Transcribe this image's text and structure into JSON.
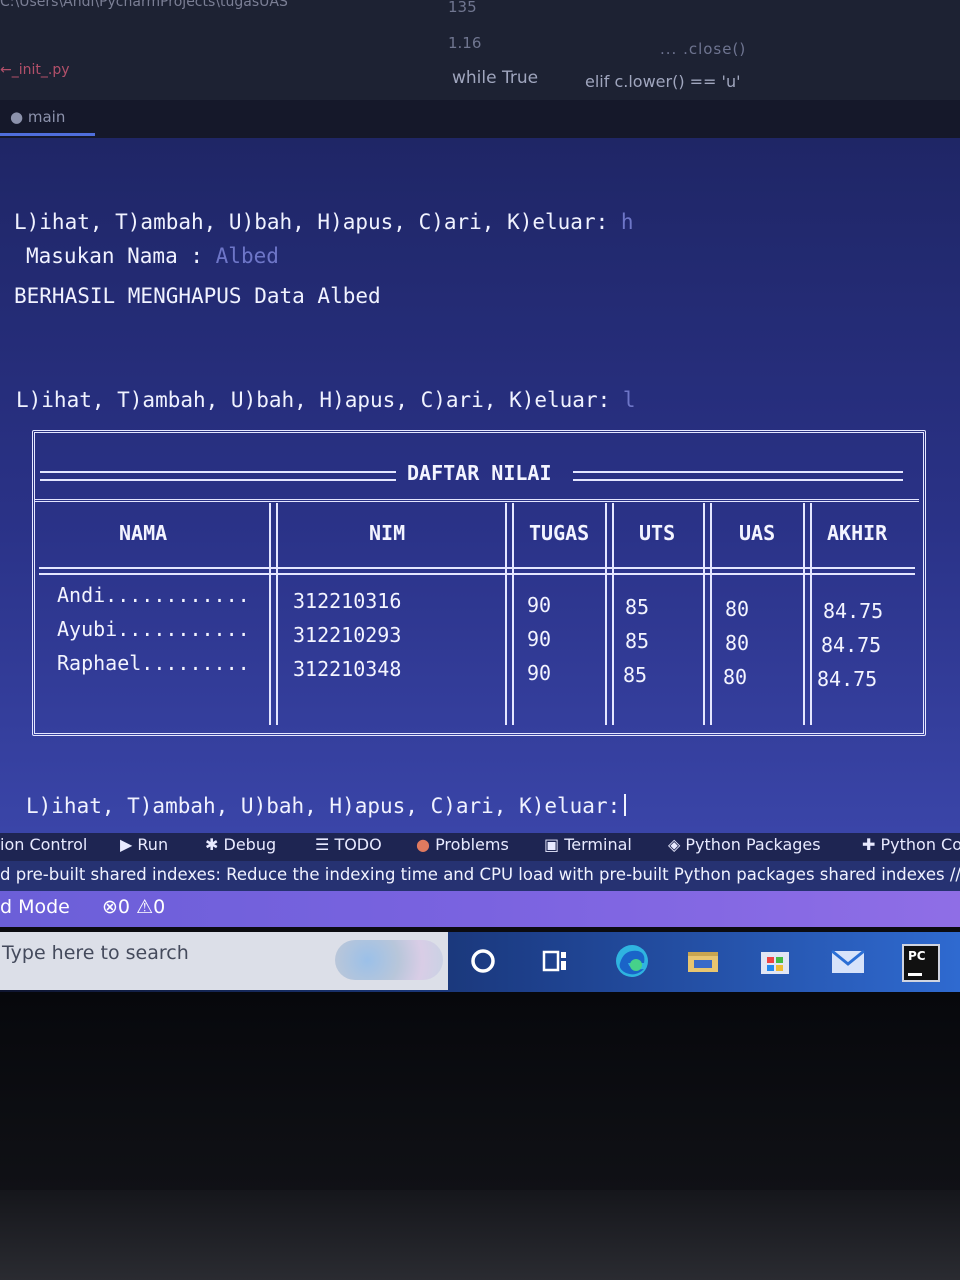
{
  "editor": {
    "path": "C:\\Users\\Andi\\PycharmProjects\\tugasUAS",
    "tab": "←_init_.py",
    "gutter": [
      "135",
      "1.16"
    ],
    "code_line1": "while True",
    "code_line2": "elif c.lower() == 'u'",
    "code_top": "... .close()",
    "branch": "main"
  },
  "console": {
    "menu_prompt": "L)ihat, T)ambah, U)bah, H)apus, C)ari, K)eluar:",
    "input1": "h",
    "name_prompt": "Masukan Nama : ",
    "name_input": "Albed",
    "delete_msg": "BERHASIL MENGHAPUS Data Albed",
    "input2": "l",
    "final_prompt": "L)ihat, T)ambah, U)bah, H)apus, C)ari, K)eluar:"
  },
  "table": {
    "title": "DAFTAR NILAI",
    "headers": [
      "NAMA",
      "NIM",
      "TUGAS",
      "UTS",
      "UAS",
      "AKHIR"
    ],
    "rows": [
      [
        "Andi............",
        "312210316",
        "90",
        "85",
        "80",
        "84.75"
      ],
      [
        "Ayubi...........",
        "312210293",
        "90",
        "85",
        "80",
        "84.75"
      ],
      [
        "Raphael.........",
        "312210348",
        "90",
        "85",
        "80",
        "84.75"
      ]
    ]
  },
  "toolbar": {
    "version_control": "ion Control",
    "run": "Run",
    "debug": "Debug",
    "todo": "TODO",
    "problems": "Problems",
    "terminal": "Terminal",
    "python_packages": "Python Packages",
    "python_console": "Python Co"
  },
  "notice": "d pre-built shared indexes: Reduce the indexing time and CPU load with pre-built Python packages shared indexes // Alwa",
  "statusbar": {
    "mode": "d Mode",
    "errors": "0",
    "warnings": "0"
  },
  "taskbar": {
    "search_placeholder": "Type here to search",
    "icons": [
      "cortana-icon",
      "task-view-icon",
      "edge-icon",
      "file-explorer-icon",
      "store-icon",
      "mail-icon",
      "pycharm-icon"
    ],
    "pycharm_label": "PC"
  },
  "colors": {
    "console_bg": "#2a3287",
    "statusbar_bg": "#7a63e0",
    "notice_bg": "#263272",
    "text": "#f0f2ff"
  }
}
